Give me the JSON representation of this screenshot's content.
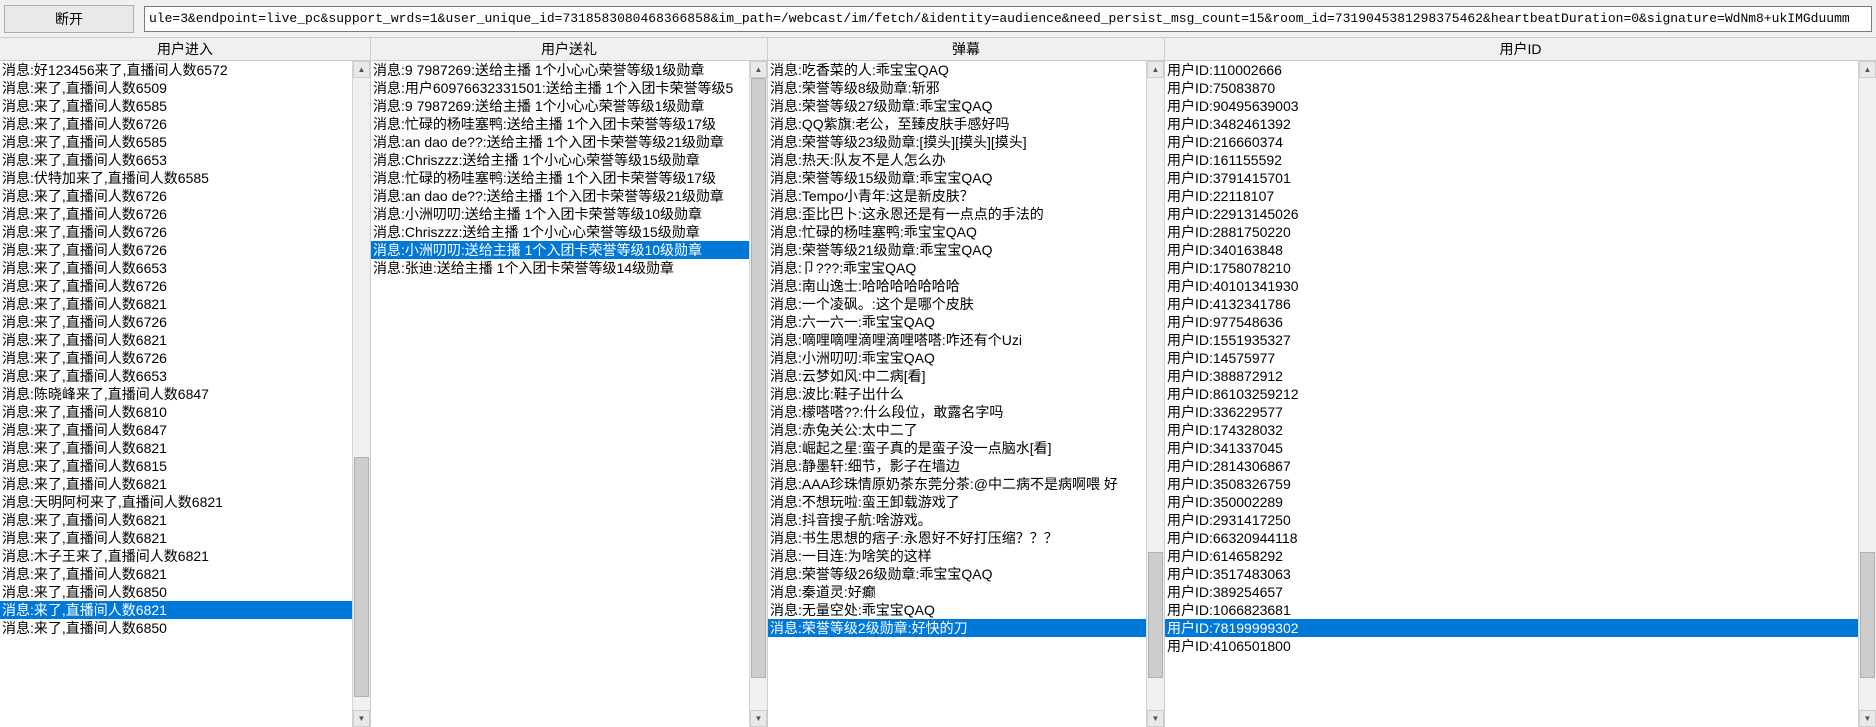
{
  "toolbar": {
    "disconnect_label": "断开",
    "url_value": "ule=3&endpoint=live_pc&support_wrds=1&user_unique_id=7318583080468366858&im_path=/webcast/im/fetch/&identity=audience&need_persist_msg_count=15&room_id=7319045381298375462&heartbeatDuration=0&signature=WdNm8+ukIMGduumm"
  },
  "columns": {
    "enter": {
      "header": "用户进入",
      "items": [
        {
          "text": "消息:好123456来了,直播间人数6572",
          "selected": false
        },
        {
          "text": "消息:来了,直播间人数6509",
          "selected": false
        },
        {
          "text": "消息:来了,直播间人数6585",
          "selected": false
        },
        {
          "text": "消息:来了,直播间人数6726",
          "selected": false
        },
        {
          "text": "消息:来了,直播间人数6585",
          "selected": false
        },
        {
          "text": "消息:来了,直播间人数6653",
          "selected": false
        },
        {
          "text": "消息:伏特加来了,直播间人数6585",
          "selected": false
        },
        {
          "text": "消息:来了,直播间人数6726",
          "selected": false
        },
        {
          "text": "消息:来了,直播间人数6726",
          "selected": false
        },
        {
          "text": "消息:来了,直播间人数6726",
          "selected": false
        },
        {
          "text": "消息:来了,直播间人数6726",
          "selected": false
        },
        {
          "text": "消息:来了,直播间人数6653",
          "selected": false
        },
        {
          "text": "消息:来了,直播间人数6726",
          "selected": false
        },
        {
          "text": "消息:来了,直播间人数6821",
          "selected": false
        },
        {
          "text": "消息:来了,直播间人数6726",
          "selected": false
        },
        {
          "text": "消息:来了,直播间人数6821",
          "selected": false
        },
        {
          "text": "消息:来了,直播间人数6726",
          "selected": false
        },
        {
          "text": "消息:来了,直播间人数6653",
          "selected": false
        },
        {
          "text": "消息:陈晓峰来了,直播间人数6847",
          "selected": false
        },
        {
          "text": "消息:来了,直播间人数6810",
          "selected": false
        },
        {
          "text": "消息:来了,直播间人数6847",
          "selected": false
        },
        {
          "text": "消息:来了,直播间人数6821",
          "selected": false
        },
        {
          "text": "消息:来了,直播间人数6815",
          "selected": false
        },
        {
          "text": "消息:来了,直播间人数6821",
          "selected": false
        },
        {
          "text": "消息:天明阿柯来了,直播间人数6821",
          "selected": false
        },
        {
          "text": "消息:来了,直播间人数6821",
          "selected": false
        },
        {
          "text": "消息:来了,直播间人数6821",
          "selected": false
        },
        {
          "text": "消息:木子王来了,直播间人数6821",
          "selected": false
        },
        {
          "text": "消息:来了,直播间人数6821",
          "selected": false
        },
        {
          "text": "消息:来了,直播间人数6850",
          "selected": false
        },
        {
          "text": "消息:来了,直播间人数6821",
          "selected": true
        },
        {
          "text": "消息:来了,直播间人数6850",
          "selected": false
        }
      ]
    },
    "gift": {
      "header": "用户送礼",
      "items": [
        {
          "text": "消息:9 7987269:送给主播 1个小心心荣誉等级1级勋章",
          "selected": false
        },
        {
          "text": "消息:用户60976632331501:送给主播 1个入团卡荣誉等级5",
          "selected": false
        },
        {
          "text": "消息:9 7987269:送给主播 1个小心心荣誉等级1级勋章",
          "selected": false
        },
        {
          "text": "消息:忙碌的杨哇塞鸭:送给主播 1个入团卡荣誉等级17级",
          "selected": false
        },
        {
          "text": "消息:an dao de??:送给主播 1个入团卡荣誉等级21级勋章",
          "selected": false
        },
        {
          "text": "消息:Chriszzz:送给主播 1个小心心荣誉等级15级勋章",
          "selected": false
        },
        {
          "text": "消息:忙碌的杨哇塞鸭:送给主播 1个入团卡荣誉等级17级",
          "selected": false
        },
        {
          "text": "消息:an dao de??:送给主播 1个入团卡荣誉等级21级勋章",
          "selected": false
        },
        {
          "text": "消息:小洲叨叨:送给主播 1个入团卡荣誉等级10级勋章",
          "selected": false
        },
        {
          "text": "消息:Chriszzz:送给主播 1个小心心荣誉等级15级勋章",
          "selected": false
        },
        {
          "text": "消息:小洲叨叨:送给主播 1个入团卡荣誉等级10级勋章",
          "selected": true
        },
        {
          "text": "消息:张迪:送给主播 1个入团卡荣誉等级14级勋章",
          "selected": false
        }
      ]
    },
    "danmu": {
      "header": "弹幕",
      "items": [
        {
          "text": "消息:吃香菜的人:乖宝宝QAQ",
          "selected": false
        },
        {
          "text": "消息:荣誉等级8级勋章:斩邪",
          "selected": false
        },
        {
          "text": "消息:荣誉等级27级勋章:乖宝宝QAQ",
          "selected": false
        },
        {
          "text": "消息:QQ紫旗:老公，至臻皮肤手感好吗",
          "selected": false
        },
        {
          "text": "消息:荣誉等级23级勋章:[摸头][摸头][摸头]",
          "selected": false
        },
        {
          "text": "消息:热天:队友不是人怎么办",
          "selected": false
        },
        {
          "text": "消息:荣誉等级15级勋章:乖宝宝QAQ",
          "selected": false
        },
        {
          "text": "消息:Tempo小青年:这是新皮肤？",
          "selected": false
        },
        {
          "text": "消息:歪比巴卜:这永恩还是有一点点的手法的",
          "selected": false
        },
        {
          "text": "消息:忙碌的杨哇塞鸭:乖宝宝QAQ",
          "selected": false
        },
        {
          "text": "消息:荣誉等级21级勋章:乖宝宝QAQ",
          "selected": false
        },
        {
          "text": "消息:卩???:乖宝宝QAQ",
          "selected": false
        },
        {
          "text": "消息:南山逸士:哈哈哈哈哈哈哈",
          "selected": false
        },
        {
          "text": "消息:一个凌砜。:这个是哪个皮肤",
          "selected": false
        },
        {
          "text": "消息:六一六一:乖宝宝QAQ",
          "selected": false
        },
        {
          "text": "消息:嘀哩嘀哩滴哩滴哩嗒嗒:咋还有个Uzi",
          "selected": false
        },
        {
          "text": "消息:小洲叨叨:乖宝宝QAQ",
          "selected": false
        },
        {
          "text": "消息:云梦如风:中二病[看]",
          "selected": false
        },
        {
          "text": "消息:波比:鞋子出什么",
          "selected": false
        },
        {
          "text": "消息:檬嗒嗒??:什么段位，敢露名字吗",
          "selected": false
        },
        {
          "text": "消息:赤兔关公:太中二了",
          "selected": false
        },
        {
          "text": "消息:崛起之星:蛮子真的是蛮子没一点脑水[看]",
          "selected": false
        },
        {
          "text": "消息:静墨轩:细节，影子在墙边",
          "selected": false
        },
        {
          "text": "消息:AAA珍珠情原奶茶东莞分茶:@中二病不是病啊喂  好",
          "selected": false
        },
        {
          "text": "消息:不想玩啦:蛮王卸载游戏了",
          "selected": false
        },
        {
          "text": "消息:抖音搜子航:啥游戏。",
          "selected": false
        },
        {
          "text": "消息:书生思想的痞子:永恩好不好打压缩？？？",
          "selected": false
        },
        {
          "text": "消息:一目连:为啥笑的这样",
          "selected": false
        },
        {
          "text": "消息:荣誉等级26级勋章:乖宝宝QAQ",
          "selected": false
        },
        {
          "text": "消息:秦道灵:好癫",
          "selected": false
        },
        {
          "text": "消息:无量空处:乖宝宝QAQ",
          "selected": false
        },
        {
          "text": "消息:荣誉等级2级勋章:好快的刀",
          "selected": true
        }
      ]
    },
    "userid": {
      "header": "用户ID",
      "items": [
        {
          "text": "用户ID:110002666",
          "selected": false
        },
        {
          "text": "用户ID:75083870",
          "selected": false
        },
        {
          "text": "用户ID:90495639003",
          "selected": false
        },
        {
          "text": "用户ID:3482461392",
          "selected": false
        },
        {
          "text": "用户ID:216660374",
          "selected": false
        },
        {
          "text": "用户ID:161155592",
          "selected": false
        },
        {
          "text": "用户ID:3791415701",
          "selected": false
        },
        {
          "text": "用户ID:22118107",
          "selected": false
        },
        {
          "text": "用户ID:22913145026",
          "selected": false
        },
        {
          "text": "用户ID:2881750220",
          "selected": false
        },
        {
          "text": "用户ID:340163848",
          "selected": false
        },
        {
          "text": "用户ID:1758078210",
          "selected": false
        },
        {
          "text": "用户ID:40101341930",
          "selected": false
        },
        {
          "text": "用户ID:4132341786",
          "selected": false
        },
        {
          "text": "用户ID:977548636",
          "selected": false
        },
        {
          "text": "用户ID:1551935327",
          "selected": false
        },
        {
          "text": "用户ID:14575977",
          "selected": false
        },
        {
          "text": "用户ID:388872912",
          "selected": false
        },
        {
          "text": "用户ID:86103259212",
          "selected": false
        },
        {
          "text": "用户ID:336229577",
          "selected": false
        },
        {
          "text": "用户ID:174328032",
          "selected": false
        },
        {
          "text": "用户ID:341337045",
          "selected": false
        },
        {
          "text": "用户ID:2814306867",
          "selected": false
        },
        {
          "text": "用户ID:3508326759",
          "selected": false
        },
        {
          "text": "用户ID:350002289",
          "selected": false
        },
        {
          "text": "用户ID:2931417250",
          "selected": false
        },
        {
          "text": "用户ID:66320944118",
          "selected": false
        },
        {
          "text": "用户ID:614658292",
          "selected": false
        },
        {
          "text": "用户ID:3517483063",
          "selected": false
        },
        {
          "text": "用户ID:389254657",
          "selected": false
        },
        {
          "text": "用户ID:1066823681",
          "selected": false
        },
        {
          "text": "用户ID:78199999302",
          "selected": true
        },
        {
          "text": "用户ID:4106501800",
          "selected": false
        }
      ]
    }
  }
}
